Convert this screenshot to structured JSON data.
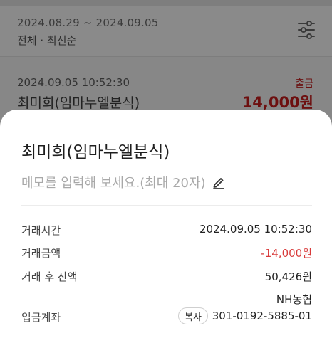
{
  "list": {
    "period": "2024.08.29 ~ 2024.09.05",
    "filter": "전체 · 최신순",
    "filter_icon": "sliders-icon",
    "transaction": {
      "datetime": "2024.09.05 10:52:30",
      "name": "최미희(임마누엘분식)",
      "type": "출금",
      "amount": "14,000원"
    }
  },
  "sheet": {
    "title": "최미희(임마누엘분식)",
    "memo_placeholder": "메모를 입력해 보세요.(최대 20자)",
    "memo_icon": "pencil-icon",
    "rows": {
      "time_label": "거래시간",
      "time_value": "2024.09.05 10:52:30",
      "amount_label": "거래금액",
      "amount_value": "-14,000원",
      "balance_label": "거래 후 잔액",
      "balance_value": "50,426원",
      "bank_name": "NH농협",
      "account_label": "입금계좌",
      "account_value": "301-0192-5885-01",
      "copy_label": "복사"
    }
  },
  "colors": {
    "negative": "#d83a3a",
    "dim_background": "#878787",
    "sheet": "#ffffff"
  }
}
